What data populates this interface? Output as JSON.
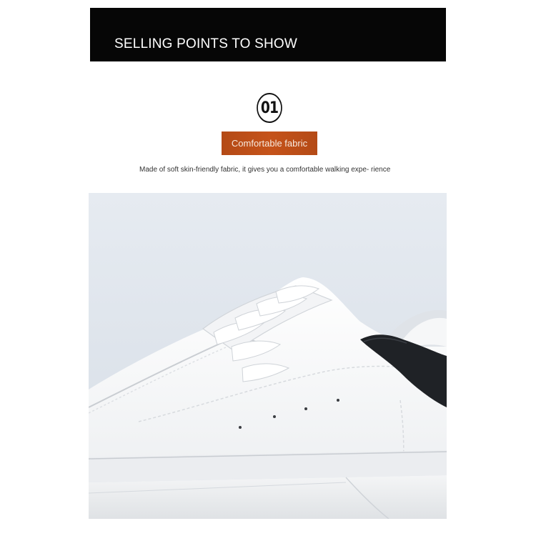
{
  "banner": {
    "title": "SELLING POINTS TO SHOW"
  },
  "feature": {
    "number": "01",
    "tag": "Comfortable fabric",
    "description": "Made of soft skin-friendly fabric, it gives you a comfortable walking expe- rience"
  },
  "photo": {
    "subject": "white-sneaker-with-black-heel-tab"
  },
  "colors": {
    "banner_bg": "#060606",
    "tag_bg": "#c5531a",
    "photo_bg": "#e1e7ee"
  }
}
